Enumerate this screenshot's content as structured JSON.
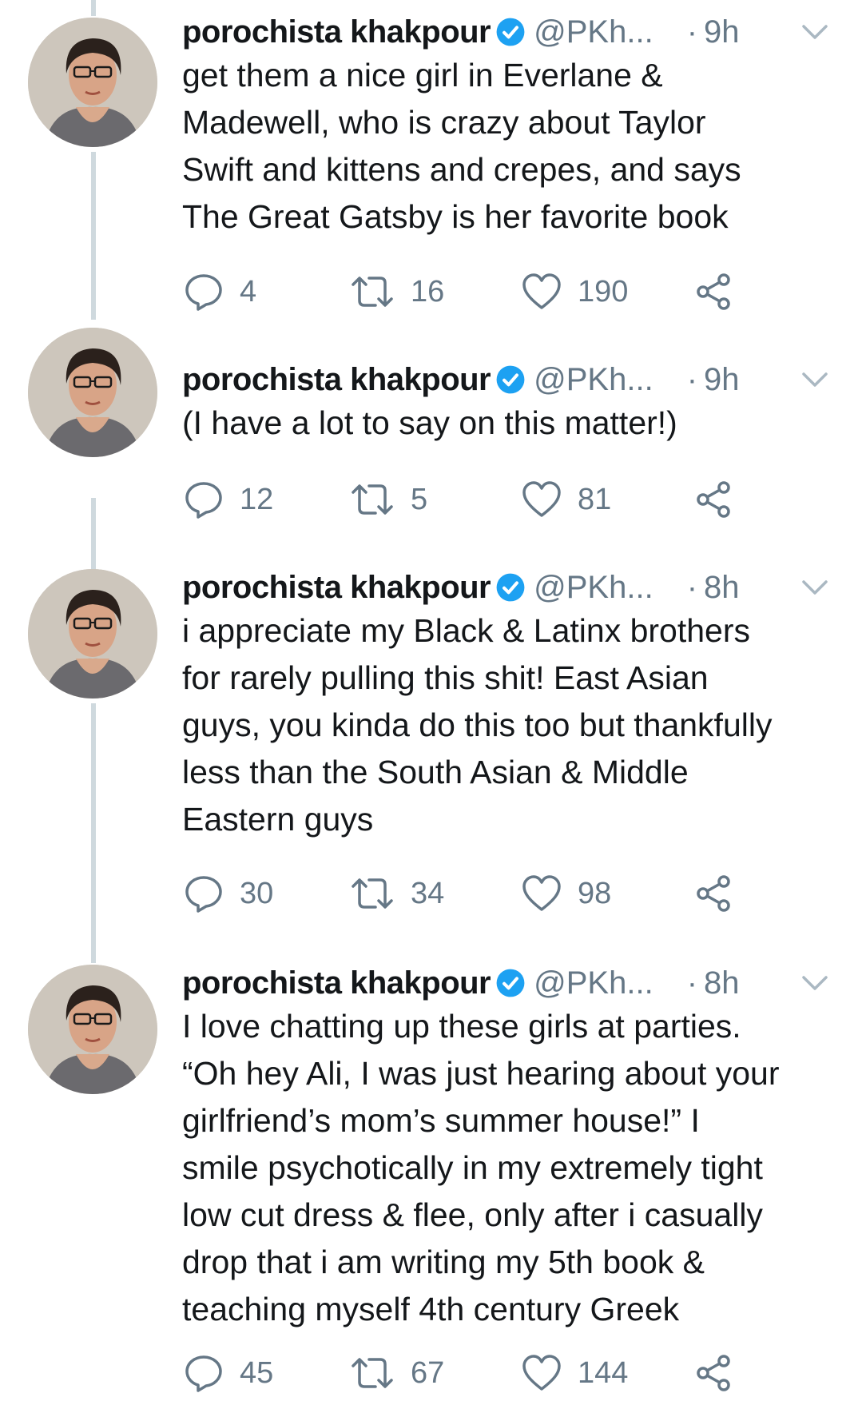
{
  "tweets": [
    {
      "name": "porochista khakpour",
      "handle": "@PKh...",
      "time": "9h",
      "text_lines": [
        "get them a nice girl in Everlane &",
        "Madewell, who is crazy about Taylor",
        "Swift and kittens and crepes, and says",
        "The Great Gatsby is her favorite book"
      ],
      "replies": "4",
      "retweets": "16",
      "likes": "190"
    },
    {
      "name": "porochista khakpour",
      "handle": "@PKh...",
      "time": "9h",
      "text_lines": [
        "(I have a lot to say on this matter!)"
      ],
      "replies": "12",
      "retweets": "5",
      "likes": "81"
    },
    {
      "name": "porochista khakpour",
      "handle": "@PKh...",
      "time": "8h",
      "text_lines": [
        "i appreciate my Black & Latinx brothers",
        "for rarely pulling this shit! East Asian",
        "guys, you kinda do this too but thankfully",
        "less than the South Asian & Middle",
        "Eastern guys"
      ],
      "replies": "30",
      "retweets": "34",
      "likes": "98"
    },
    {
      "name": "porochista khakpour",
      "handle": "@PKh...",
      "time": "8h",
      "text_lines": [
        "I love chatting up these girls at parties.",
        "“Oh hey Ali, I was just hearing about your",
        "girlfriend’s mom’s summer house!” I",
        "smile psychotically in my extremely tight",
        "low cut dress & flee, only after i casually",
        "drop that i am writing my 5th book &",
        "teaching myself 4th century Greek"
      ],
      "replies": "45",
      "retweets": "67",
      "likes": "144"
    }
  ],
  "separator": "·",
  "colors": {
    "text": "#14171a",
    "secondary": "#657786",
    "verified": "#1da1f2",
    "thread_line": "#cfd9de"
  },
  "icons": {
    "reply": "reply-icon",
    "retweet": "retweet-icon",
    "like": "like-icon",
    "share": "share-icon",
    "verified": "verified-badge-icon",
    "caret": "chevron-down-icon"
  }
}
